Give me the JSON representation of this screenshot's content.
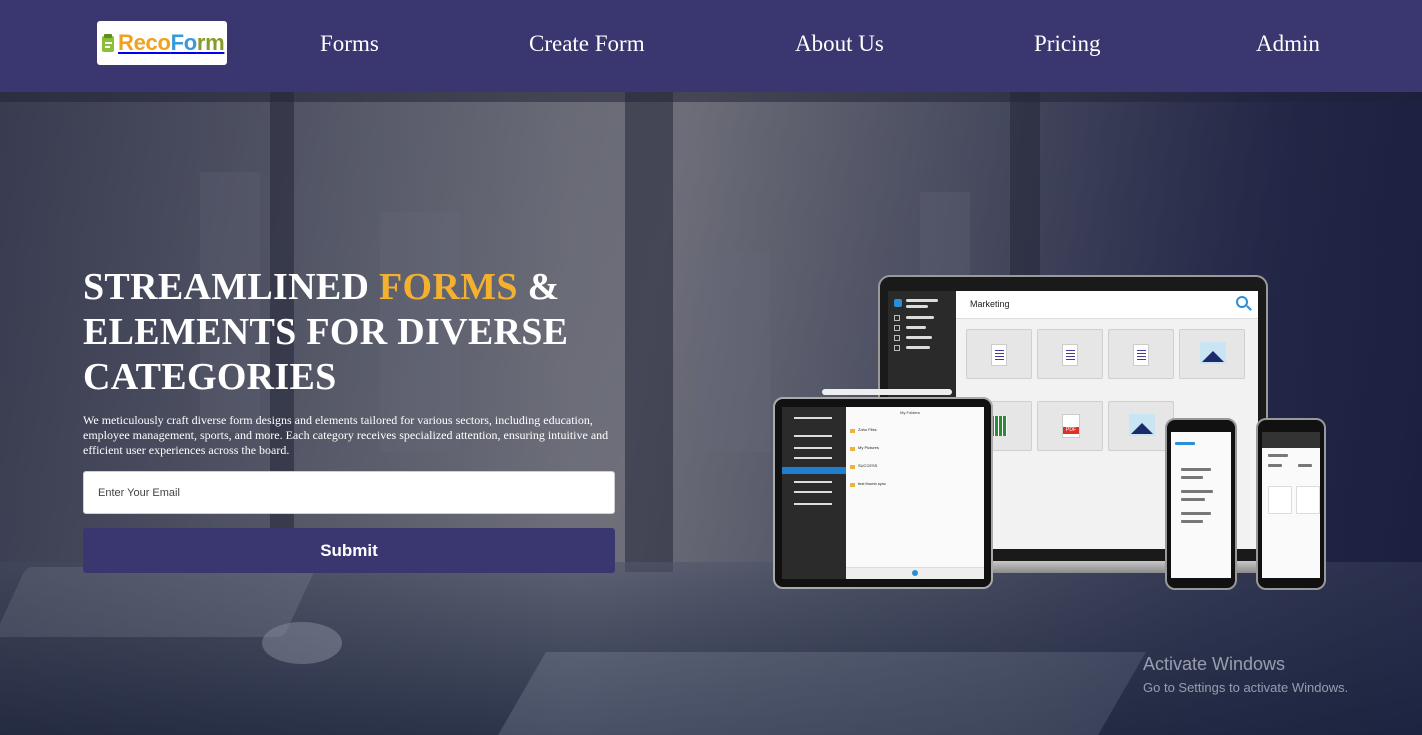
{
  "nav": {
    "logo": {
      "part1": "Reco",
      "part2": "Fo",
      "part3": "rm",
      "alt": "RecoForm"
    },
    "links": [
      {
        "label": "Forms"
      },
      {
        "label": "Create Form"
      },
      {
        "label": "About Us"
      },
      {
        "label": "Pricing"
      },
      {
        "label": "Admin"
      }
    ]
  },
  "hero": {
    "headline_part1": "STREAMLINED ",
    "headline_accent": "FORMS",
    "headline_part2": " & ELEMENTS FOR DIVERSE CATEGORIES",
    "description": "We meticulously craft diverse form designs and elements tailored for various sectors, including education, employee management, sports, and more. Each category receives specialized attention, ensuring intuitive and efficient user experiences across the board.",
    "email_placeholder": "Enter Your Email",
    "submit_label": "Submit"
  },
  "mockup": {
    "laptop_title": "Marketing",
    "tablet_title": "My Folders",
    "tablet_folders": [
      "Zoho Files",
      "My Pictures",
      "SUCCESS",
      "test thumb sync"
    ]
  },
  "watermark": {
    "title": "Activate Windows",
    "subtitle": "Go to Settings to activate Windows."
  },
  "colors": {
    "nav_bg": "#3a3670",
    "accent": "#f4b02f",
    "button_bg": "#3a3670"
  }
}
